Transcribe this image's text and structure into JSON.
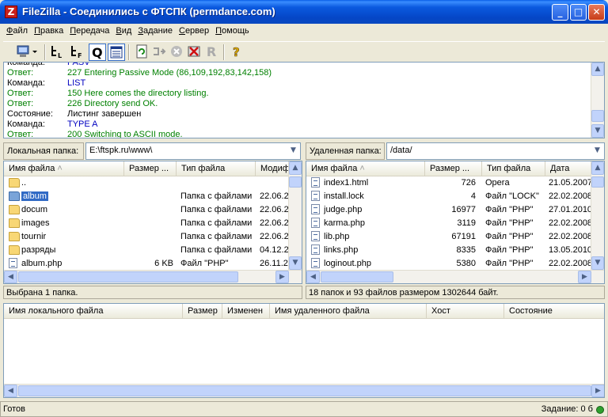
{
  "window": {
    "title": "FileZilla - Соединились с ФТСПК (permdance.com)",
    "app_icon_glyph": "Z",
    "minimize_glyph": "_",
    "maximize_glyph": "□",
    "close_glyph": "✕"
  },
  "menu": {
    "file": "Файл",
    "edit": "Правка",
    "transfer": "Передача",
    "view": "Вид",
    "task": "Задание",
    "server": "Сервер",
    "help": "Помощь"
  },
  "toolbar": {
    "icons": [
      "site-manager-icon",
      "toggle-log-icon",
      "toggle-local-tree-icon",
      "toggle-queue-icon",
      "toggle-remote-tree-icon",
      "refresh-icon",
      "process-queue-icon",
      "cancel-icon",
      "disconnect-icon",
      "reconnect-icon",
      "help-icon"
    ]
  },
  "log": {
    "lines": [
      {
        "key": "Команда:",
        "value": "PASV",
        "color": "blue"
      },
      {
        "key": "Ответ:",
        "value": "227 Entering Passive Mode (86,109,192,83,142,158)",
        "color": "green"
      },
      {
        "key": "Команда:",
        "value": "LIST",
        "color": "blue"
      },
      {
        "key": "Ответ:",
        "value": "150 Here comes the directory listing.",
        "color": "green"
      },
      {
        "key": "Ответ:",
        "value": "226 Directory send OK.",
        "color": "green"
      },
      {
        "key": "Состояние:",
        "value": "Листинг завершен",
        "color": "black"
      },
      {
        "key": "Команда:",
        "value": "TYPE A",
        "color": "blue"
      },
      {
        "key": "Ответ:",
        "value": "200 Switching to ASCII mode.",
        "color": "green"
      }
    ]
  },
  "local": {
    "path_label": "Локальная папка:",
    "path": "E:\\ftspk.ru\\www\\",
    "columns": [
      "Имя файла",
      "Размер ...",
      "Тип файла",
      "Модиф"
    ],
    "rows": [
      {
        "name": "..",
        "size": "",
        "type": "",
        "date": "",
        "kind": "folder",
        "selected": false
      },
      {
        "name": "album",
        "size": "",
        "type": "Папка с файлами",
        "date": "22.06.2",
        "kind": "folder",
        "selected": true
      },
      {
        "name": "docum",
        "size": "",
        "type": "Папка с файлами",
        "date": "22.06.2",
        "kind": "folder",
        "selected": false
      },
      {
        "name": "images",
        "size": "",
        "type": "Папка с файлами",
        "date": "22.06.2",
        "kind": "folder",
        "selected": false
      },
      {
        "name": "tournir",
        "size": "",
        "type": "Папка с файлами",
        "date": "22.06.2",
        "kind": "folder",
        "selected": false
      },
      {
        "name": "разряды",
        "size": "",
        "type": "Папка с файлами",
        "date": "04.12.2",
        "kind": "folder",
        "selected": false
      },
      {
        "name": "album.php",
        "size": "6 KB",
        "type": "Файл \"PHP\"",
        "date": "26.11.2",
        "kind": "file",
        "selected": false
      }
    ],
    "status": "Выбрана 1 папка."
  },
  "remote": {
    "path_label": "Удаленная папка:",
    "path": "/data/",
    "columns": [
      "Имя файла",
      "Размер ...",
      "Тип файла",
      "Дата"
    ],
    "rows": [
      {
        "name": "index1.html",
        "size": "726",
        "type": "Opera",
        "date": "21.05.2007",
        "kind": "file"
      },
      {
        "name": "install.lock",
        "size": "4",
        "type": "Файл \"LOCK\"",
        "date": "22.02.2008",
        "kind": "file"
      },
      {
        "name": "judge.php",
        "size": "16977",
        "type": "Файл \"PHP\"",
        "date": "27.01.2010",
        "kind": "file"
      },
      {
        "name": "karma.php",
        "size": "3119",
        "type": "Файл \"PHP\"",
        "date": "22.02.2008",
        "kind": "file"
      },
      {
        "name": "lib.php",
        "size": "67191",
        "type": "Файл \"PHP\"",
        "date": "22.02.2008",
        "kind": "file"
      },
      {
        "name": "links.php",
        "size": "8335",
        "type": "Файл \"PHP\"",
        "date": "13.05.2010",
        "kind": "file"
      },
      {
        "name": "loginout.php",
        "size": "5380",
        "type": "Файл \"PHP\"",
        "date": "22.02.2008",
        "kind": "file"
      }
    ],
    "status": "18 папок и 93 файлов размером 1302644 байт."
  },
  "queue": {
    "columns": [
      "Имя локального файла",
      "Размер",
      "Изменен",
      "Имя удаленного файла",
      "Хост",
      "Состояние"
    ]
  },
  "statusbar": {
    "ready": "Готов",
    "queue": "Задание: 0 б"
  },
  "colors": {
    "accent": "#316ac5",
    "log_green": "#008000",
    "log_blue": "#0000c0"
  }
}
